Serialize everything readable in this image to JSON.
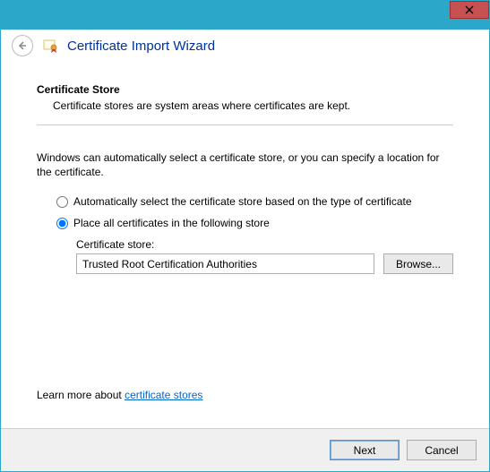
{
  "header": {
    "title": "Certificate Import Wizard"
  },
  "section": {
    "title": "Certificate Store",
    "description": "Certificate stores are system areas where certificates are kept."
  },
  "instructions": "Windows can automatically select a certificate store, or you can specify a location for the certificate.",
  "radio": {
    "auto_label": "Automatically select the certificate store based on the type of certificate",
    "manual_label": "Place all certificates in the following store",
    "selected": "manual"
  },
  "store": {
    "label": "Certificate store:",
    "value": "Trusted Root Certification Authorities",
    "browse_label": "Browse..."
  },
  "learn_more": {
    "prefix": "Learn more about ",
    "link_text": "certificate stores"
  },
  "footer": {
    "next_label": "Next",
    "cancel_label": "Cancel"
  }
}
